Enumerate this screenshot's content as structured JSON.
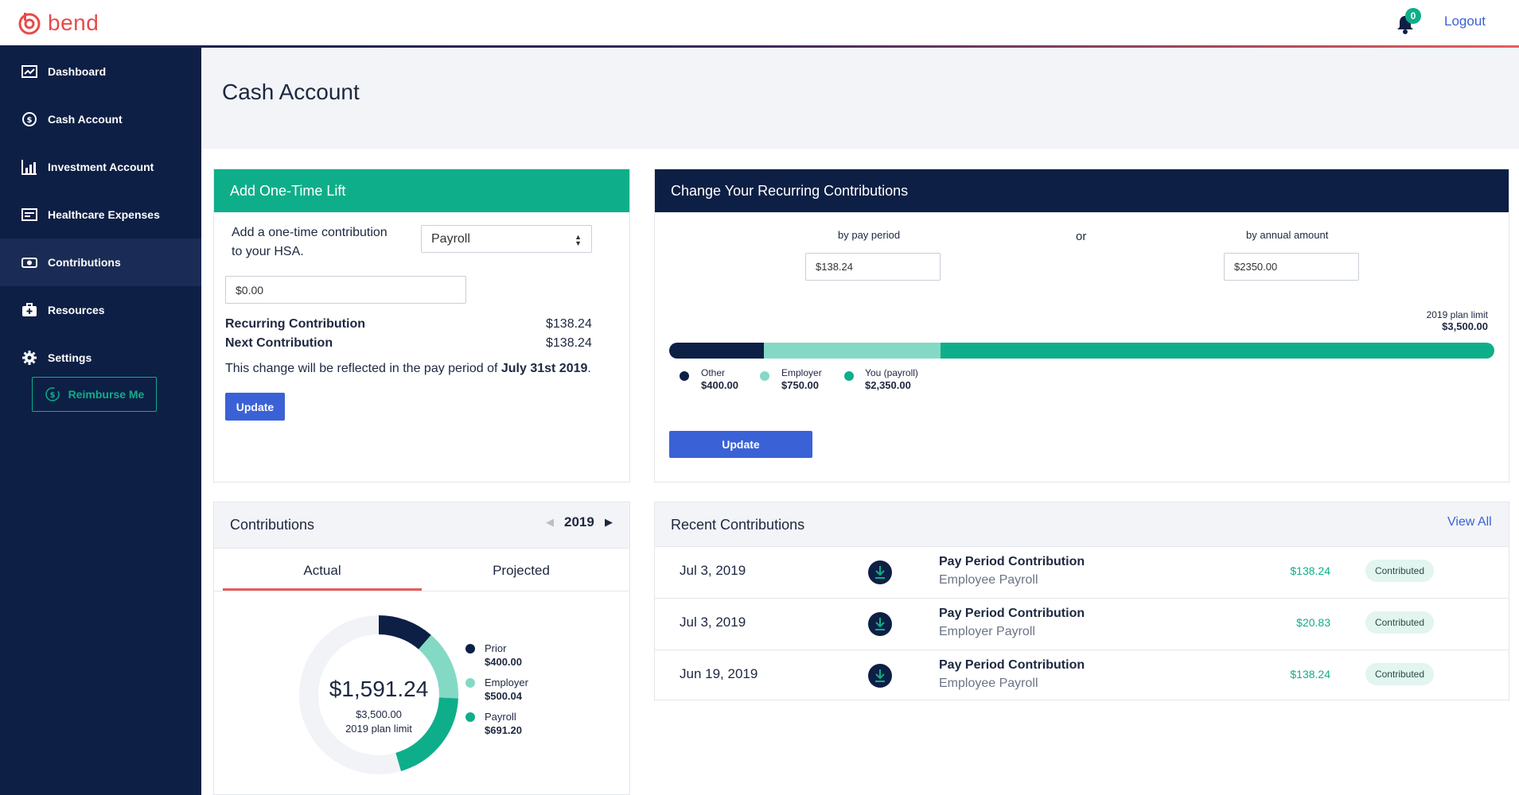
{
  "brand": {
    "name": "bend",
    "accent": "#e84a4a"
  },
  "header": {
    "notifications_count": "0",
    "logout_label": "Logout"
  },
  "sidebar": {
    "items": [
      {
        "label": "Dashboard",
        "icon": "dashboard-icon"
      },
      {
        "label": "Cash Account",
        "icon": "dollar-coin-icon"
      },
      {
        "label": "Investment Account",
        "icon": "chart-icon"
      },
      {
        "label": "Healthcare Expenses",
        "icon": "receipt-icon"
      },
      {
        "label": "Contributions",
        "icon": "money-icon"
      },
      {
        "label": "Resources",
        "icon": "medical-kit-icon"
      },
      {
        "label": "Settings",
        "icon": "gear-icon"
      }
    ],
    "active": "Contributions",
    "reimburse_label": "Reimburse Me"
  },
  "page": {
    "title": "Cash Account"
  },
  "one_time_lift": {
    "title": "Add One-Time Lift",
    "description_line1": "Add a one-time contribution",
    "description_line2": "to your HSA.",
    "source_selected": "Payroll",
    "amount_value": "$0.00",
    "recurring_label": "Recurring Contribution",
    "recurring_value": "$138.24",
    "next_label": "Next Contribution",
    "next_value": "$138.24",
    "note_prefix": "This change will be reflected in the pay period of",
    "note_date": "July 31st 2019",
    "note_suffix": ".",
    "update_label": "Update"
  },
  "recurring": {
    "title": "Change Your Recurring Contributions",
    "pay_period_label": "by pay period",
    "pay_period_value": "$138.24",
    "or_label": "or",
    "annual_label": "by annual amount",
    "annual_value": "$2350.00",
    "limit_label": "2019 plan limit",
    "limit_value": "$3,500.00",
    "segments": [
      {
        "name": "Other",
        "value": "$400.00",
        "amount": 400,
        "color": "#0d1f45"
      },
      {
        "name": "Employer",
        "value": "$750.00",
        "amount": 750,
        "color": "#84d9c5"
      },
      {
        "name": "You (payroll)",
        "value": "$2,350.00",
        "amount": 2350,
        "color": "#0fae8a"
      }
    ],
    "update_label": "Update"
  },
  "contributions": {
    "title": "Contributions",
    "year": "2019",
    "tabs": [
      "Actual",
      "Projected"
    ],
    "active_tab": "Actual",
    "total": "$1,591.24",
    "limit_value": "$3,500.00",
    "limit_label": "2019 plan limit",
    "chart_data": {
      "type": "pie",
      "labels": [
        "Prior",
        "Employer",
        "Payroll"
      ],
      "values": [
        400.0,
        500.04,
        691.2
      ],
      "display_values": [
        "$400.00",
        "$500.04",
        "$691.20"
      ],
      "colors": [
        "#0d1f45",
        "#84d9c5",
        "#0fae8a"
      ],
      "total": 3500.0,
      "remaining_color": "#f1f3f6"
    }
  },
  "recent": {
    "title": "Recent Contributions",
    "view_all_label": "View All",
    "rows": [
      {
        "date": "Jul 3, 2019",
        "title": "Pay Period Contribution",
        "source": "Employee Payroll",
        "amount": "$138.24",
        "status": "Contributed"
      },
      {
        "date": "Jul 3, 2019",
        "title": "Pay Period Contribution",
        "source": "Employer Payroll",
        "amount": "$20.83",
        "status": "Contributed"
      },
      {
        "date": "Jun 19, 2019",
        "title": "Pay Period Contribution",
        "source": "Employee Payroll",
        "amount": "$138.24",
        "status": "Contributed"
      }
    ]
  }
}
